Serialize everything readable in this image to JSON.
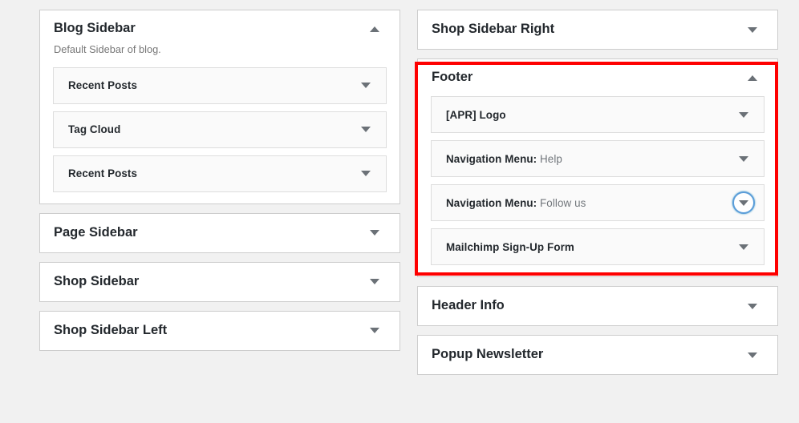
{
  "page": {
    "background_color": "#f1f1f1",
    "panel_background": "#ffffff",
    "widget_row_background": "#fafafa",
    "title_color": "#23282d",
    "muted_text_color": "#72777c",
    "highlight_color": "#fe0000",
    "focus_ring_color": "#5b9dd9"
  },
  "highlight": {
    "name": "footer-sidebar-highlight",
    "target": "Footer"
  },
  "left_column": {
    "panels": [
      {
        "title": "Blog Sidebar",
        "description": "Default Sidebar of blog.",
        "expanded": true,
        "toggle_icon": "chevron-up-icon",
        "widgets": [
          {
            "label": "Recent Posts",
            "sub_label": "",
            "toggle_icon": "chevron-down-icon",
            "focused": false
          },
          {
            "label": "Tag Cloud",
            "sub_label": "",
            "toggle_icon": "chevron-down-icon",
            "focused": false
          },
          {
            "label": "Recent Posts",
            "sub_label": "",
            "toggle_icon": "chevron-down-icon",
            "focused": false
          }
        ]
      },
      {
        "title": "Page Sidebar",
        "description": "",
        "expanded": false,
        "toggle_icon": "chevron-down-icon",
        "widgets": []
      },
      {
        "title": "Shop Sidebar",
        "description": "",
        "expanded": false,
        "toggle_icon": "chevron-down-icon",
        "widgets": []
      },
      {
        "title": "Shop Sidebar Left",
        "description": "",
        "expanded": false,
        "toggle_icon": "chevron-down-icon",
        "widgets": []
      }
    ]
  },
  "right_column": {
    "panels": [
      {
        "title": "Shop Sidebar Right",
        "description": "",
        "expanded": false,
        "toggle_icon": "chevron-down-icon",
        "widgets": []
      },
      {
        "title": "Footer",
        "description": "",
        "expanded": true,
        "highlighted": true,
        "toggle_icon": "chevron-up-icon",
        "widgets": [
          {
            "label": "[APR] Logo",
            "sub_label": "",
            "toggle_icon": "chevron-down-icon",
            "focused": false
          },
          {
            "label": "Navigation Menu:",
            "sub_label": "Help",
            "toggle_icon": "chevron-down-icon",
            "focused": false
          },
          {
            "label": "Navigation Menu:",
            "sub_label": "Follow us",
            "toggle_icon": "chevron-down-icon",
            "focused": true
          },
          {
            "label": "Mailchimp Sign-Up Form",
            "sub_label": "",
            "toggle_icon": "chevron-down-icon",
            "focused": false
          }
        ]
      },
      {
        "title": "Header Info",
        "description": "",
        "expanded": false,
        "toggle_icon": "chevron-down-icon",
        "widgets": []
      },
      {
        "title": "Popup Newsletter",
        "description": "",
        "expanded": false,
        "toggle_icon": "chevron-down-icon",
        "widgets": []
      }
    ]
  }
}
